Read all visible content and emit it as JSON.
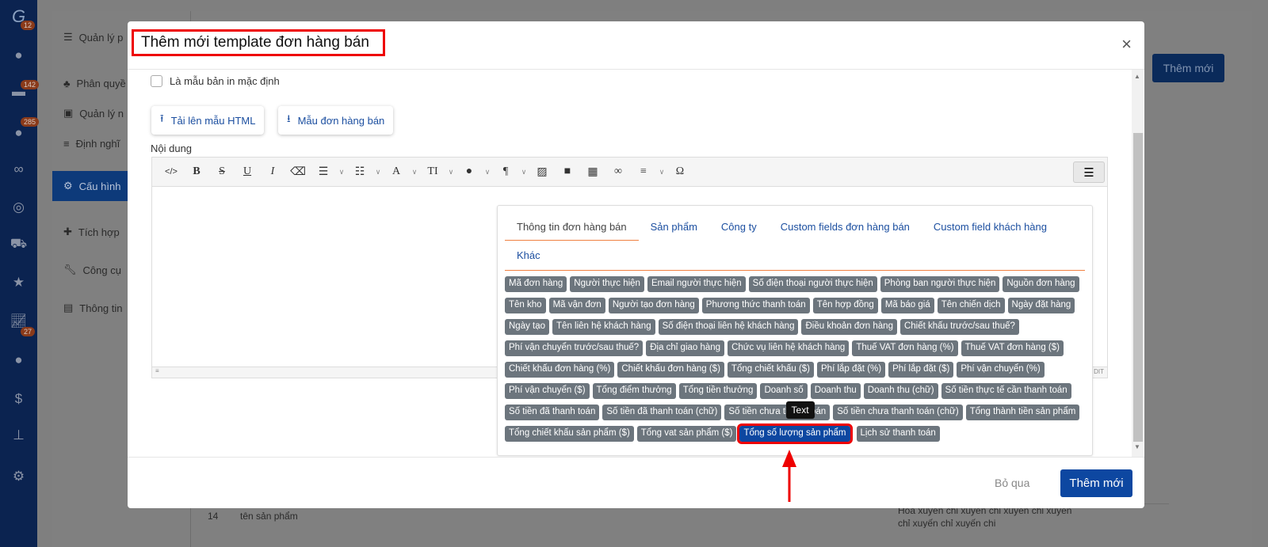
{
  "rail": {
    "badges": [
      "12",
      "142",
      "285",
      "27"
    ],
    "icons": [
      "logo-icon",
      "user-icon",
      "briefcase-icon",
      "users-icon",
      "handshake-icon",
      "target-icon",
      "cart-icon",
      "star-icon",
      "chart-icon",
      "person-icon",
      "dollar-icon",
      "org-icon",
      "gear-icon"
    ]
  },
  "submenu": [
    {
      "label": "Quản lý p"
    },
    {
      "label": "Phân quyề"
    },
    {
      "label": "Quản lý n"
    },
    {
      "label": "Định nghĩ"
    },
    {
      "label": "Cấu hình"
    },
    {
      "label": "Tích hợp"
    },
    {
      "label": "Công cụ"
    },
    {
      "label": "Thông tin"
    }
  ],
  "background": {
    "add_label": "Thêm mới",
    "row_num": "14",
    "row_name": "tên sản phẩm",
    "row_desc": "Hóa xuyến chỉ xuyến chỉ xuyến chỉ xuyến chỉ xuyến chỉ xuyến chi"
  },
  "modal": {
    "title": "Thêm mới template đơn hàng bán",
    "close": "×",
    "default_checkbox": "Là mẫu bản in mặc định",
    "upload_label": "Tải lên mẫu HTML",
    "sample_label": "Mẫu đơn hàng bán",
    "content_label": "Nội dung",
    "statusbar_right": "DIT",
    "tabs": [
      "Thông tin đơn hàng bán",
      "Sản phẩm",
      "Công ty",
      "Custom fields đơn hàng bán",
      "Custom field khách hàng",
      "Khác"
    ],
    "active_tab": "Thông tin đơn hàng bán",
    "tags": [
      "Mã đơn hàng",
      "Người thực hiện",
      "Email người thực hiện",
      "Số điện thoại người thực hiện",
      "Phòng ban người thực hiện",
      "Nguồn đơn hàng",
      "Tên kho",
      "Mã vận đơn",
      "Người tạo đơn hàng",
      "Phương thức thanh toán",
      "Tên hợp đồng",
      "Mã báo giá",
      "Tên chiến dịch",
      "Ngày đặt hàng",
      "Ngày tạo",
      "Tên liên hệ khách hàng",
      "Số điện thoại liên hệ khách hàng",
      "Điều khoản đơn hàng",
      "Chiết khấu trước/sau thuế?",
      "Phí vận chuyển trước/sau thuế?",
      "Địa chỉ giao hàng",
      "Chức vụ liên hệ khách hàng",
      "Thuế VAT đơn hàng (%)",
      "Thuế VAT đơn hàng ($)",
      "Chiết khấu đơn hàng (%)",
      "Chiết khấu đơn hàng ($)",
      "Tổng chiết khấu ($)",
      "Phí lắp đặt (%)",
      "Phí lắp đặt ($)",
      "Phí vận chuyển (%)",
      "Phí vận chuyển ($)",
      "Tổng điểm thưởng",
      "Tổng tiền thưởng",
      "Doanh số",
      "Doanh thu",
      "Doanh thu (chữ)",
      "Số tiền thực tế cần thanh toán",
      "Số tiền đã thanh toán",
      "Số tiền đã thanh toán (chữ)",
      "Số tiền chưa thanh toán",
      "Số tiền chưa thanh toán (chữ)",
      "Tổng thành tiền sản phẩm",
      "Tổng chiết khấu sản phẩm ($)",
      "Tổng vat sản phẩm ($)",
      "Tổng số lượng sản phẩm",
      "Lịch sử thanh toán"
    ],
    "selected_tag": "Tổng số lượng sản phẩm",
    "tooltip": "Text",
    "cancel_label": "Bỏ qua",
    "submit_label": "Thêm mới"
  },
  "colors": {
    "primary": "#0d47a1",
    "tag": "#6c757d",
    "highlight": "#ee0000",
    "tab_underline": "#f08040"
  }
}
